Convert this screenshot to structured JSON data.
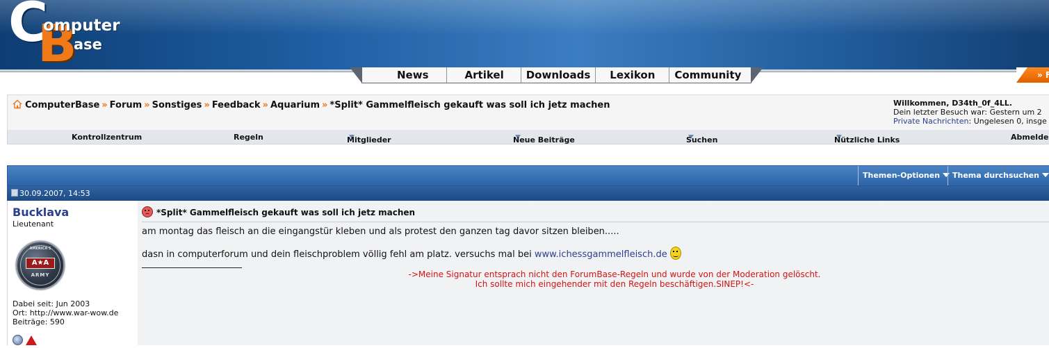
{
  "logo": {
    "c": "C",
    "b": "B",
    "line1": "omputer",
    "line2": "ase"
  },
  "main_nav": [
    "News",
    "Artikel",
    "Downloads",
    "Lexikon",
    "Community"
  ],
  "corner_button": "» F",
  "breadcrumb": [
    "ComputerBase",
    "Forum",
    "Sonstiges",
    "Feedback",
    "Aquarium",
    "*Split* Gammelfleisch gekauft was soll ich jetz machen"
  ],
  "breadcrumb_sep": "»",
  "welcome": {
    "greeting": "Willkommen, D34th_0f_4LL.",
    "last_visit": "Dein letzter Besuch war: Gestern um 2",
    "pm_link": "Private Nachrichten",
    "pm_status": ": Ungelesen 0, insge"
  },
  "sub_nav": {
    "kontrollzentrum": "Kontrollzentrum",
    "regeln": "Regeln",
    "mitglieder": "Mitglieder",
    "neue_beitraege": "Neue Beiträge",
    "suchen": "Suchen",
    "nuetzliche_links": "Nützliche Links",
    "abmelden": "Abmelden"
  },
  "thread_tools": {
    "options": "Themen-Optionen",
    "search": "Thema durchsuchen"
  },
  "post": {
    "date": "30.09.2007, 14:53",
    "user": {
      "name": "Bucklava",
      "rank": "Lieutenant",
      "avatar_top": "AMERICA'S",
      "avatar_mid": "A★A",
      "avatar_bottom": "ARMY",
      "joined": "Dabei seit: Jun 2003",
      "location": "Ort: http://www.war-wow.de",
      "posts": "Beiträge: 590"
    },
    "title": "*Split* Gammelfleisch gekauft was soll ich jetz machen",
    "line1": "am montag das fleisch an die eingangstür kleben und als protest den ganzen tag davor sitzen bleiben.....",
    "line2_text": "dasn in computerforum und dein fleischproblem völlig fehl am platz. versuchs mal bei ",
    "line2_link": "www.ichessgammelfleisch.de",
    "signature_line1": "->Meine Signatur entsprach nicht den ForumBase-Regeln und wurde von der Moderation gelöscht.",
    "signature_line2": "Ich sollte mich eingehender mit den Regeln beschäftigen.SINEP!<-"
  },
  "icons": {
    "home": "house-icon",
    "post": "post-icon",
    "title_smiley": "angry-face-icon",
    "inline_smiley": "smiley-icon",
    "status": "online-status-icon",
    "report": "warning-icon"
  },
  "colors": {
    "orange": "#e8751a",
    "link": "#2b3f8f",
    "signature": "#d01414",
    "bar_blue": "#2f62a0"
  }
}
